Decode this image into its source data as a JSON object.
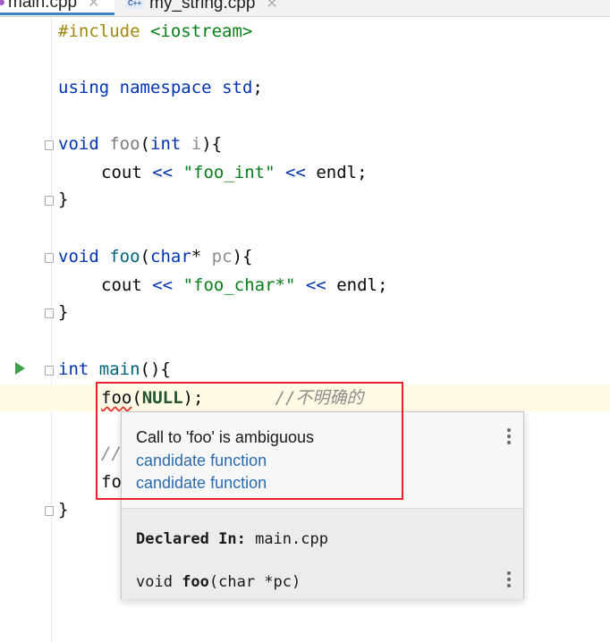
{
  "tabs": [
    {
      "label": "main.cpp",
      "close": "✕"
    },
    {
      "label": "my_string.cpp",
      "badge": "C++",
      "close": "✕"
    }
  ],
  "code": {
    "line1": {
      "pp": "#include",
      "rest": " <iostream>"
    },
    "line2": {
      "kw1": "using",
      "kw2": "namespace",
      "kw3": "std",
      "punct": ";"
    },
    "line3": {
      "kw": "void",
      "fn": "foo",
      "open": "(",
      "ptype": "int",
      "param": "i",
      "close": "){"
    },
    "line4": {
      "ident": "cout",
      "op1": "<<",
      "str": "\"foo_int\"",
      "op2": "<<",
      "ident2": "endl",
      "end": ";"
    },
    "line5": {
      "brace": "}"
    },
    "line6": {
      "kw": "void",
      "fn": "foo",
      "open": "(",
      "ptype": "char",
      "star": "*",
      "param": "pc",
      "close": "){"
    },
    "line7": {
      "ident": "cout",
      "op1": "<<",
      "str": "\"foo_char*\"",
      "op2": "<<",
      "ident2": "endl",
      "end": ";"
    },
    "line8": {
      "brace": "}"
    },
    "line9": {
      "kw": "int",
      "fn": "main",
      "rest": "(){"
    },
    "line10": {
      "call": "foo",
      "open": "(",
      "macro": "NULL",
      "close": ");",
      "comment": "//不明确的"
    },
    "line11": {
      "partial": "//"
    },
    "line12": {
      "partial": "fo"
    },
    "line13": {
      "brace": "}"
    }
  },
  "popup": {
    "message": "Call to 'foo' is ambiguous",
    "candidates": [
      "candidate function",
      "candidate function"
    ],
    "declared_label": "Declared In:",
    "declared_file": "main.cpp",
    "signature": {
      "prefix": "void ",
      "name": "foo",
      "suffix": "(char *pc)"
    }
  },
  "colors": {
    "keyword": "#0033b3",
    "string": "#067d17",
    "comment": "#8c8c8c",
    "link": "#2a6bb0",
    "highlight_box": "#e3242b",
    "run_icon": "#3fa24a"
  }
}
